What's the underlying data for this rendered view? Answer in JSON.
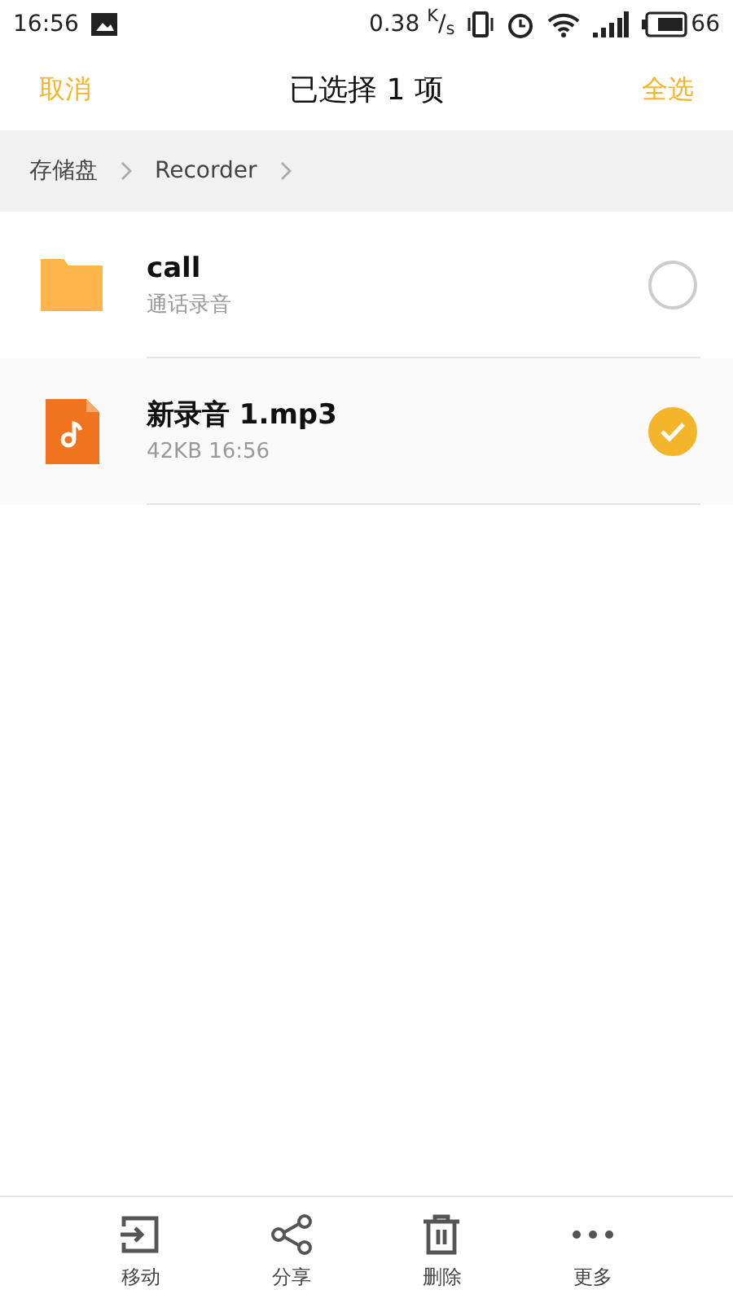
{
  "status_bar": {
    "time": "16:56",
    "speed": "0.38 $^{K}$/$_{s}$",
    "battery": "66"
  },
  "header": {
    "cancel": "取消",
    "title": "已选择 1 项",
    "select_all": "全选"
  },
  "breadcrumb": [
    "存储盘",
    "Recorder"
  ],
  "files": [
    {
      "kind": "folder",
      "name": "call",
      "meta": "通话录音",
      "selected": false
    },
    {
      "kind": "audio",
      "name": "新录音 1.mp3",
      "meta": "42KB  16:56",
      "selected": true
    }
  ],
  "toolbar": [
    {
      "kind": "move",
      "label": "移动"
    },
    {
      "kind": "share",
      "label": "分享"
    },
    {
      "kind": "delete",
      "label": "删除"
    },
    {
      "kind": "more",
      "label": "更多"
    }
  ]
}
